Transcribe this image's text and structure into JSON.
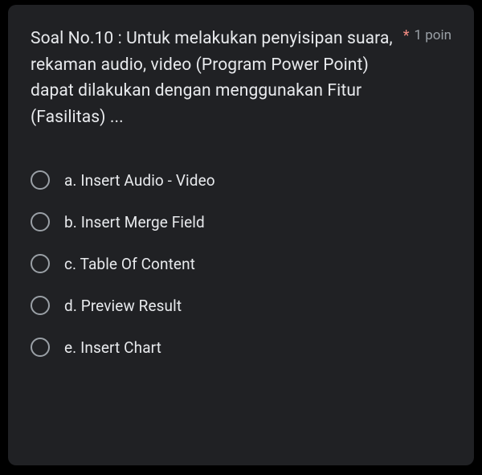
{
  "question": {
    "text": "Soal No.10 : Untuk melakukan penyisipan suara, rekaman audio, video (Program Power Point) dapat dilakukan dengan menggunakan Fitur (Fasilitas) ...",
    "required_marker": "*",
    "points_label": "1 poin"
  },
  "options": [
    {
      "label": "a. Insert Audio - Video"
    },
    {
      "label": "b. Insert Merge Field"
    },
    {
      "label": "c. Table Of Content"
    },
    {
      "label": "d. Preview Result"
    },
    {
      "label": "e. Insert Chart"
    }
  ]
}
